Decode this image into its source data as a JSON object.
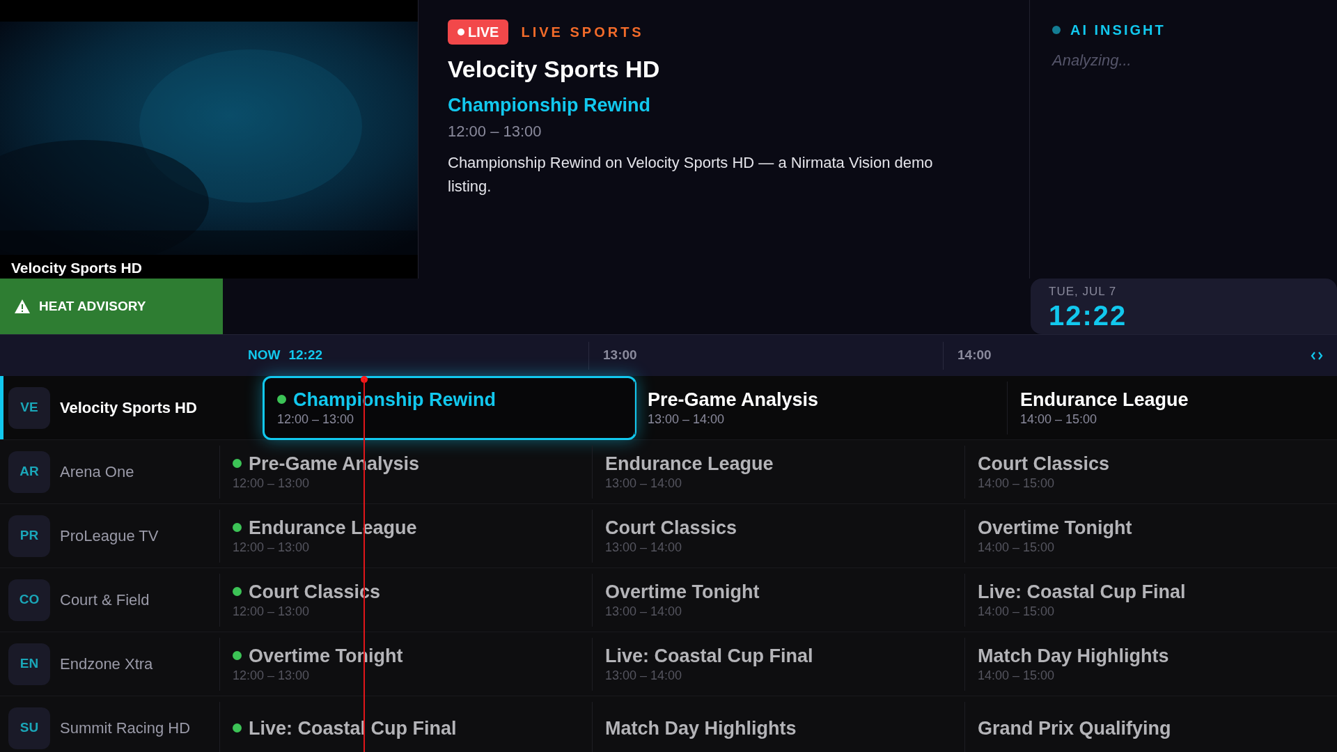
{
  "player": {
    "channel_label": "Velocity Sports HD"
  },
  "info": {
    "badge": "LIVE",
    "category": "LIVE SPORTS",
    "channel": "Velocity Sports HD",
    "program": "Championship Rewind",
    "time": "12:00 – 13:00",
    "description": "Championship Rewind on Velocity Sports HD — a Nirmata Vision demo listing."
  },
  "ai_insight": {
    "title": "AI INSIGHT",
    "status": "Analyzing..."
  },
  "alert": {
    "text": "HEAT ADVISORY"
  },
  "clock": {
    "date": "TUE, JUL 7",
    "time": "12:22"
  },
  "timeline": {
    "now_label": "NOW",
    "now_time": "12:22",
    "slots": [
      "13:00",
      "14:00"
    ]
  },
  "guide": {
    "rows": [
      {
        "abbr": "VE",
        "name": "Velocity Sports HD",
        "selected": true,
        "programs": [
          {
            "title": "Championship Rewind",
            "time": "12:00 – 13:00",
            "on_now": true,
            "focused": true
          },
          {
            "title": "Pre-Game Analysis",
            "time": "13:00 – 14:00",
            "on_now": false,
            "focused": false
          },
          {
            "title": "Endurance League",
            "time": "14:00 – 15:00",
            "on_now": false,
            "focused": false
          }
        ]
      },
      {
        "abbr": "AR",
        "name": "Arena One",
        "selected": false,
        "programs": [
          {
            "title": "Pre-Game Analysis",
            "time": "12:00 – 13:00",
            "on_now": true,
            "focused": false
          },
          {
            "title": "Endurance League",
            "time": "13:00 – 14:00",
            "on_now": false,
            "focused": false
          },
          {
            "title": "Court Classics",
            "time": "14:00 – 15:00",
            "on_now": false,
            "focused": false
          }
        ]
      },
      {
        "abbr": "PR",
        "name": "ProLeague TV",
        "selected": false,
        "programs": [
          {
            "title": "Endurance League",
            "time": "12:00 – 13:00",
            "on_now": true,
            "focused": false
          },
          {
            "title": "Court Classics",
            "time": "13:00 – 14:00",
            "on_now": false,
            "focused": false
          },
          {
            "title": "Overtime Tonight",
            "time": "14:00 – 15:00",
            "on_now": false,
            "focused": false
          }
        ]
      },
      {
        "abbr": "CO",
        "name": "Court & Field",
        "selected": false,
        "programs": [
          {
            "title": "Court Classics",
            "time": "12:00 – 13:00",
            "on_now": true,
            "focused": false
          },
          {
            "title": "Overtime Tonight",
            "time": "13:00 – 14:00",
            "on_now": false,
            "focused": false
          },
          {
            "title": "Live: Coastal Cup Final",
            "time": "14:00 – 15:00",
            "on_now": false,
            "focused": false
          }
        ]
      },
      {
        "abbr": "EN",
        "name": "Endzone Xtra",
        "selected": false,
        "programs": [
          {
            "title": "Overtime Tonight",
            "time": "12:00 – 13:00",
            "on_now": true,
            "focused": false
          },
          {
            "title": "Live: Coastal Cup Final",
            "time": "13:00 – 14:00",
            "on_now": false,
            "focused": false
          },
          {
            "title": "Match Day Highlights",
            "time": "14:00 – 15:00",
            "on_now": false,
            "focused": false
          }
        ]
      },
      {
        "abbr": "SU",
        "name": "Summit Racing HD",
        "selected": false,
        "programs": [
          {
            "title": "Live: Coastal Cup Final",
            "on_now": true,
            "focused": false
          },
          {
            "title": "Match Day Highlights",
            "on_now": false,
            "focused": false
          },
          {
            "title": "Grand Prix Qualifying",
            "on_now": false,
            "focused": false
          }
        ]
      }
    ]
  }
}
